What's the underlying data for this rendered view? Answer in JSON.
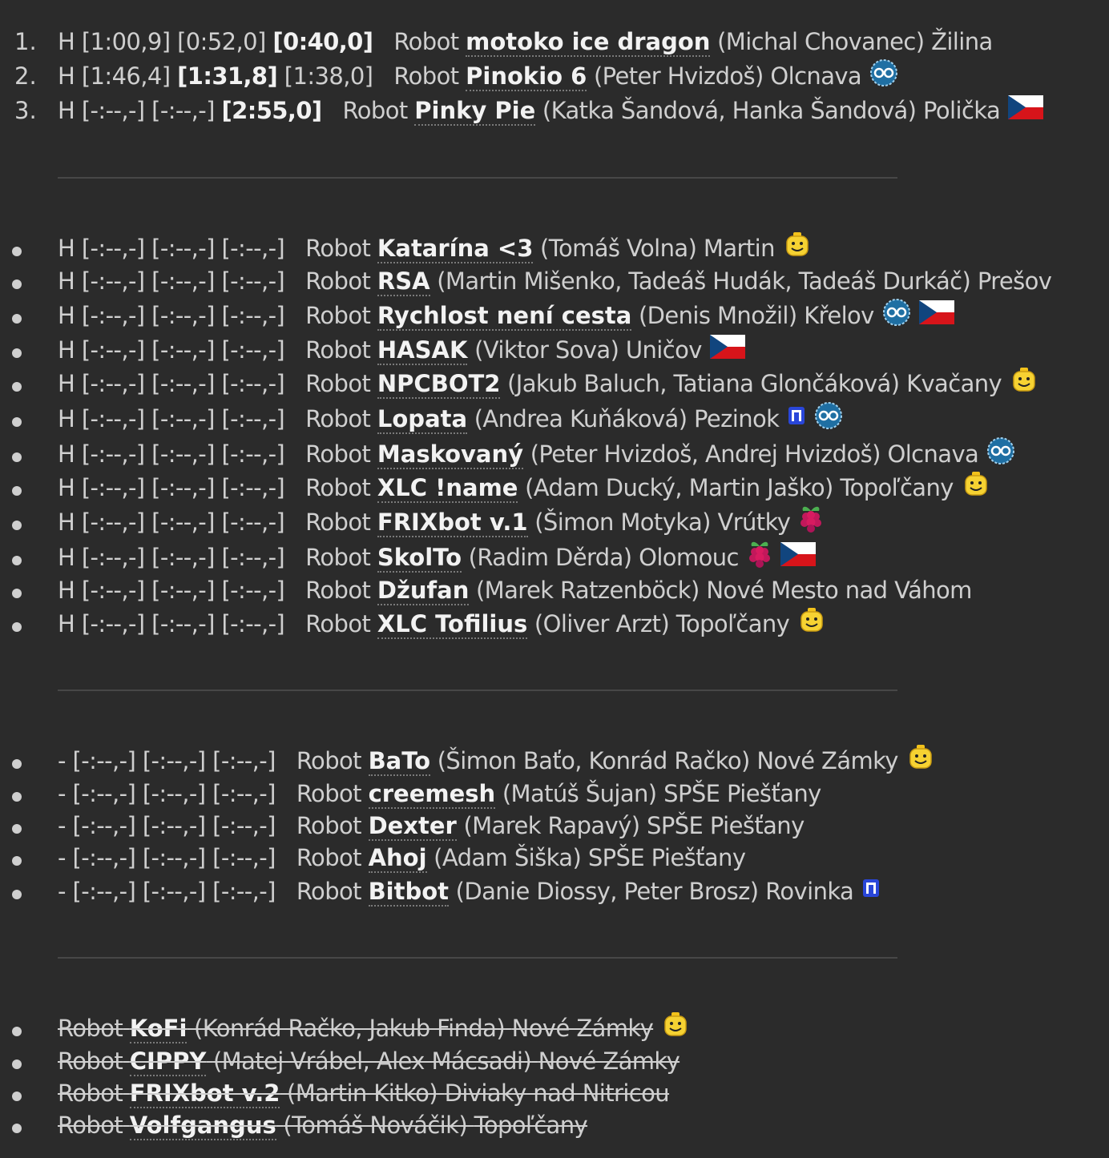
{
  "ranked": [
    {
      "num": "1.",
      "h": "H",
      "t1": "[1:00,9]",
      "t2": "[0:52,0]",
      "t3": "[0:40,0]",
      "best": 3,
      "robot": "Robot",
      "name": "motoko ice dragon",
      "team": "(Michal Chovanec)",
      "city": "Žilina",
      "icons": []
    },
    {
      "num": "2.",
      "h": "H",
      "t1": "[1:46,4]",
      "t2": "[1:31,8]",
      "t3": "[1:38,0]",
      "best": 2,
      "robot": "Robot",
      "name": "Pinokio 6",
      "team": "(Peter Hvizdoš)",
      "city": "Olcnava",
      "icons": [
        "arduino-icon"
      ]
    },
    {
      "num": "3.",
      "h": "H",
      "t1": "[-:--,-]",
      "t2": "[-:--,-]",
      "t3": "[2:55,0]",
      "best": 3,
      "robot": "Robot",
      "name": "Pinky Pie",
      "team": "(Katka Šandová, Hanka Šandová)",
      "city": "Polička",
      "icons": [
        "czech-flag-icon"
      ]
    }
  ],
  "unranked": [
    {
      "h": "H",
      "t1": "[-:--,-]",
      "t2": "[-:--,-]",
      "t3": "[-:--,-]",
      "robot": "Robot",
      "name": "Katarína <3",
      "team": "(Tomáš Volna)",
      "city": "Martin",
      "icons": [
        "lego-head-icon"
      ]
    },
    {
      "h": "H",
      "t1": "[-:--,-]",
      "t2": "[-:--,-]",
      "t3": "[-:--,-]",
      "robot": "Robot",
      "name": "RSA",
      "team": "(Martin Mišenko, Tadeáš Hudák, Tadeáš Durkáč)",
      "city": "Prešov",
      "icons": []
    },
    {
      "h": "H",
      "t1": "[-:--,-]",
      "t2": "[-:--,-]",
      "t3": "[-:--,-]",
      "robot": "Robot",
      "name": "Rychlost není cesta",
      "team": "(Denis Množil)",
      "city": "Křelov",
      "icons": [
        "arduino-icon",
        "czech-flag-icon"
      ]
    },
    {
      "h": "H",
      "t1": "[-:--,-]",
      "t2": "[-:--,-]",
      "t3": "[-:--,-]",
      "robot": "Robot",
      "name": "HASAK",
      "team": "(Viktor Sova)",
      "city": "Uničov",
      "icons": [
        "czech-flag-icon"
      ]
    },
    {
      "h": "H",
      "t1": "[-:--,-]",
      "t2": "[-:--,-]",
      "t3": "[-:--,-]",
      "robot": "Robot",
      "name": "NPCBOT2",
      "team": "(Jakub Baluch, Tatiana Glončáková)",
      "city": "Kvačany",
      "icons": [
        "lego-head-icon"
      ]
    },
    {
      "h": "H",
      "t1": "[-:--,-]",
      "t2": "[-:--,-]",
      "t3": "[-:--,-]",
      "robot": "Robot",
      "name": "Lopata",
      "team": "(Andrea Kuňáková)",
      "city": "Pezinok",
      "icons": [
        "microbit-icon",
        "arduino-icon"
      ]
    },
    {
      "h": "H",
      "t1": "[-:--,-]",
      "t2": "[-:--,-]",
      "t3": "[-:--,-]",
      "robot": "Robot",
      "name": "Maskovaný",
      "team": "(Peter Hvizdoš, Andrej Hvizdoš)",
      "city": "Olcnava",
      "icons": [
        "arduino-icon"
      ]
    },
    {
      "h": "H",
      "t1": "[-:--,-]",
      "t2": "[-:--,-]",
      "t3": "[-:--,-]",
      "robot": "Robot",
      "name": "XLC !name",
      "team": "(Adam Ducký, Martin Jaško)",
      "city": "Topoľčany",
      "icons": [
        "lego-head-icon"
      ]
    },
    {
      "h": "H",
      "t1": "[-:--,-]",
      "t2": "[-:--,-]",
      "t3": "[-:--,-]",
      "robot": "Robot",
      "name": "FRIXbot v.1",
      "team": "(Šimon Motyka)",
      "city": "Vrútky",
      "icons": [
        "raspberry-pi-icon"
      ]
    },
    {
      "h": "H",
      "t1": "[-:--,-]",
      "t2": "[-:--,-]",
      "t3": "[-:--,-]",
      "robot": "Robot",
      "name": "SkolTo",
      "team": "(Radim Děrda)",
      "city": "Olomouc",
      "icons": [
        "raspberry-pi-icon",
        "czech-flag-icon"
      ]
    },
    {
      "h": "H",
      "t1": "[-:--,-]",
      "t2": "[-:--,-]",
      "t3": "[-:--,-]",
      "robot": "Robot",
      "name": "Džufan",
      "team": "(Marek Ratzenböck)",
      "city": "Nové Mesto nad Váhom",
      "icons": []
    },
    {
      "h": "H",
      "t1": "[-:--,-]",
      "t2": "[-:--,-]",
      "t3": "[-:--,-]",
      "robot": "Robot",
      "name": "XLC Tofilius",
      "team": "(Oliver Arzt)",
      "city": "Topoľčany",
      "icons": [
        "lego-head-icon"
      ]
    }
  ],
  "not_started": [
    {
      "h": "-",
      "t1": "[-:--,-]",
      "t2": "[-:--,-]",
      "t3": "[-:--,-]",
      "robot": "Robot",
      "name": "BaTo",
      "team": "(Šimon Baťo, Konrád Račko)",
      "city": "Nové Zámky",
      "icons": [
        "lego-head-icon"
      ]
    },
    {
      "h": "-",
      "t1": "[-:--,-]",
      "t2": "[-:--,-]",
      "t3": "[-:--,-]",
      "robot": "Robot",
      "name": "creemesh",
      "team": "(Matúš Šujan)",
      "city": "SPŠE Piešťany",
      "icons": []
    },
    {
      "h": "-",
      "t1": "[-:--,-]",
      "t2": "[-:--,-]",
      "t3": "[-:--,-]",
      "robot": "Robot",
      "name": "Dexter",
      "team": "(Marek Rapavý)",
      "city": "SPŠE Piešťany",
      "icons": []
    },
    {
      "h": "-",
      "t1": "[-:--,-]",
      "t2": "[-:--,-]",
      "t3": "[-:--,-]",
      "robot": "Robot",
      "name": "Ahoj",
      "team": "(Adam Šiška)",
      "city": "SPŠE Piešťany",
      "icons": []
    },
    {
      "h": "-",
      "t1": "[-:--,-]",
      "t2": "[-:--,-]",
      "t3": "[-:--,-]",
      "robot": "Robot",
      "name": "Bitbot",
      "team": "(Danie Diossy, Peter Brosz)",
      "city": "Rovinka",
      "icons": [
        "microbit-icon"
      ]
    }
  ],
  "withdrawn": [
    {
      "robot": "Robot",
      "name": "KoFi",
      "team": "(Konrád Račko, Jakub Finda)",
      "city": "Nové Zámky",
      "icons": [
        "lego-head-icon"
      ]
    },
    {
      "robot": "Robot",
      "name": "CIPPY",
      "team": "(Matej Vrábel, Alex Mácsadi)",
      "city": "Nové Zámky",
      "icons": []
    },
    {
      "robot": "Robot",
      "name": "FRIXbot v.2",
      "team": "(Martin Kitko)",
      "city": "Diviaky nad Nitricou",
      "icons": []
    },
    {
      "robot": "Robot",
      "name": "Volfgangus",
      "team": "(Tomáš Nováčik)",
      "city": "Topoľčany",
      "icons": []
    }
  ]
}
